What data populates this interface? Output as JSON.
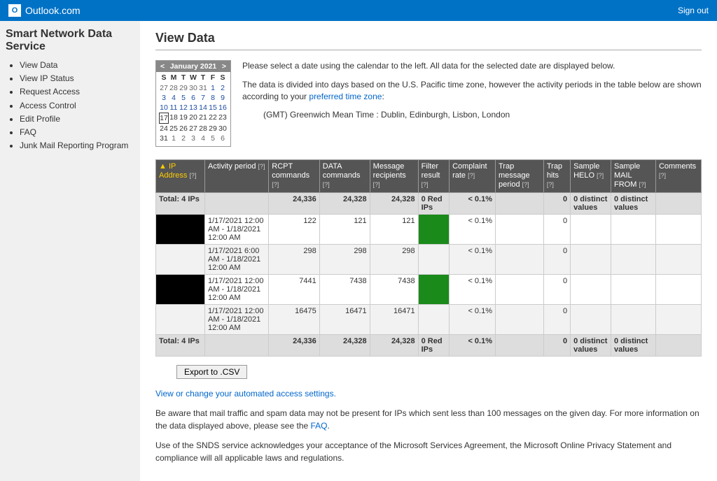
{
  "header": {
    "brand": "Outlook.com",
    "logo_letter": "O",
    "signout": "Sign out"
  },
  "sidebar": {
    "title": "Smart Network Data Service",
    "items": [
      "View Data",
      "View IP Status",
      "Request Access",
      "Access Control",
      "Edit Profile",
      "FAQ",
      "Junk Mail Reporting Program"
    ]
  },
  "page": {
    "title": "View Data",
    "intro1": "Please select a date using the calendar to the left. All data for the selected date are displayed below.",
    "intro2a": "The data is divided into days based on the U.S. Pacific time zone, however the activity periods in the table below are shown according to your ",
    "intro2link": "preferred time zone",
    "intro2b": ":",
    "tz": "(GMT) Greenwich Mean Time : Dublin, Edinburgh, Lisbon, London",
    "export_label": "Export to .CSV",
    "access_link": "View or change your automated access settings.",
    "footer1a": "Be aware that mail traffic and spam data may not be present for IPs which sent less than 100 messages on the given day.  For more information on the data displayed above, please see the ",
    "footer1link": "FAQ",
    "footer1b": ".",
    "footer2": "Use of the SNDS service acknowledges your acceptance of the Microsoft Services Agreement, the Microsoft Online Privacy Statement and compliance will all applicable laws and regulations."
  },
  "calendar": {
    "month": "January 2021",
    "dow": [
      "S",
      "M",
      "T",
      "W",
      "T",
      "F",
      "S"
    ],
    "cells": [
      {
        "n": "27",
        "t": "o"
      },
      {
        "n": "28",
        "t": "o"
      },
      {
        "n": "29",
        "t": "o"
      },
      {
        "n": "30",
        "t": "o"
      },
      {
        "n": "31",
        "t": "o"
      },
      {
        "n": "1",
        "t": "l"
      },
      {
        "n": "2",
        "t": "l"
      },
      {
        "n": "3",
        "t": "l"
      },
      {
        "n": "4",
        "t": "l"
      },
      {
        "n": "5",
        "t": "l"
      },
      {
        "n": "6",
        "t": "l"
      },
      {
        "n": "7",
        "t": "l"
      },
      {
        "n": "8",
        "t": "l"
      },
      {
        "n": "9",
        "t": "l"
      },
      {
        "n": "10",
        "t": "l"
      },
      {
        "n": "11",
        "t": "l"
      },
      {
        "n": "12",
        "t": "l"
      },
      {
        "n": "13",
        "t": "l"
      },
      {
        "n": "14",
        "t": "l"
      },
      {
        "n": "15",
        "t": "l"
      },
      {
        "n": "16",
        "t": "l"
      },
      {
        "n": "17",
        "t": "s"
      },
      {
        "n": "18",
        "t": ""
      },
      {
        "n": "19",
        "t": ""
      },
      {
        "n": "20",
        "t": ""
      },
      {
        "n": "21",
        "t": ""
      },
      {
        "n": "22",
        "t": ""
      },
      {
        "n": "23",
        "t": ""
      },
      {
        "n": "24",
        "t": ""
      },
      {
        "n": "25",
        "t": ""
      },
      {
        "n": "26",
        "t": ""
      },
      {
        "n": "27",
        "t": ""
      },
      {
        "n": "28",
        "t": ""
      },
      {
        "n": "29",
        "t": ""
      },
      {
        "n": "30",
        "t": ""
      },
      {
        "n": "31",
        "t": ""
      },
      {
        "n": "1",
        "t": "o"
      },
      {
        "n": "2",
        "t": "o"
      },
      {
        "n": "3",
        "t": "o"
      },
      {
        "n": "4",
        "t": "o"
      },
      {
        "n": "5",
        "t": "o"
      },
      {
        "n": "6",
        "t": "o"
      }
    ]
  },
  "table": {
    "headers": {
      "ip": "IP Address",
      "activity": "Activity period",
      "rcpt": "RCPT commands",
      "data": "DATA commands",
      "recip": "Message recipients",
      "filter": "Filter result",
      "complaint": "Complaint rate",
      "trap_period": "Trap message period",
      "trap_hits": "Trap hits",
      "helo": "Sample HELO",
      "mailfrom": "Sample MAIL FROM",
      "comments": "Comments"
    },
    "totals_label": "Total: 4 IPs",
    "totals": {
      "rcpt": "24,336",
      "data": "24,328",
      "recip": "24,328",
      "filter": "0 Red IPs",
      "complaint": "< 0.1%",
      "trap_hits": "0",
      "helo": "0 distinct values",
      "mailfrom": "0 distinct values"
    },
    "rows": [
      {
        "activity": "1/17/2021 12:00 AM - 1/18/2021 12:00 AM",
        "rcpt": "122",
        "data": "121",
        "recip": "121",
        "complaint": "< 0.1%",
        "trap_hits": "0"
      },
      {
        "activity": "1/17/2021 6:00 AM - 1/18/2021 12:00 AM",
        "rcpt": "298",
        "data": "298",
        "recip": "298",
        "complaint": "< 0.1%",
        "trap_hits": "0"
      },
      {
        "activity": "1/17/2021 12:00 AM - 1/18/2021 12:00 AM",
        "rcpt": "7441",
        "data": "7438",
        "recip": "7438",
        "complaint": "< 0.1%",
        "trap_hits": "0"
      },
      {
        "activity": "1/17/2021 12:00 AM - 1/18/2021 12:00 AM",
        "rcpt": "16475",
        "data": "16471",
        "recip": "16471",
        "complaint": "< 0.1%",
        "trap_hits": "0"
      }
    ]
  }
}
